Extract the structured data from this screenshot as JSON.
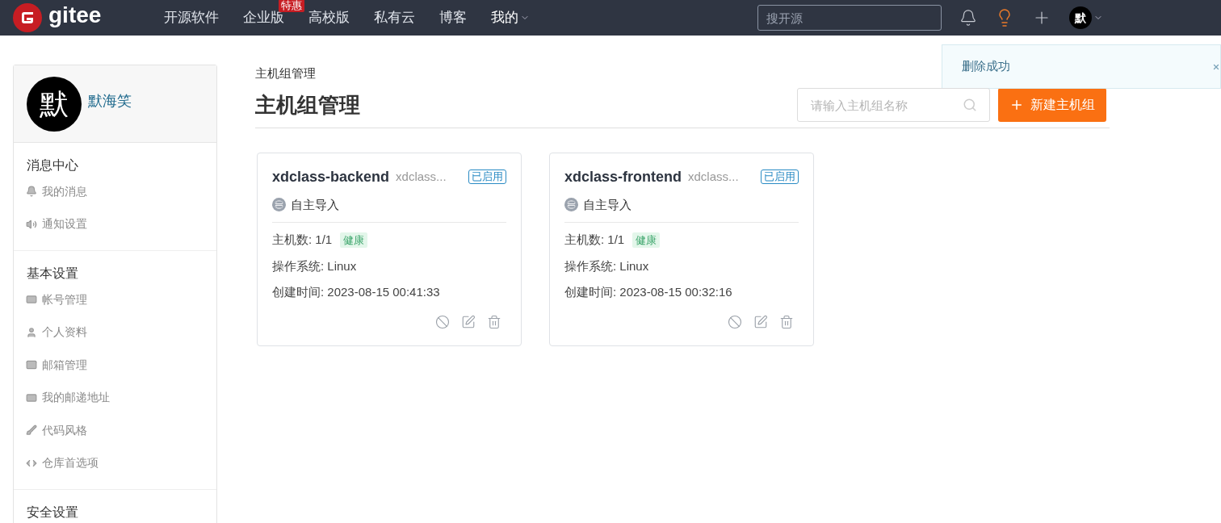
{
  "header": {
    "logo": "gitee",
    "nav": [
      {
        "label": "开源软件",
        "dropdown": false
      },
      {
        "label": "企业版",
        "badge": "特惠",
        "dropdown": false
      },
      {
        "label": "高校版",
        "dropdown": false
      },
      {
        "label": "私有云",
        "dropdown": false
      },
      {
        "label": "博客",
        "dropdown": false
      },
      {
        "label": "我的",
        "dropdown": true
      }
    ],
    "search": {
      "placeholder": "搜开源"
    },
    "avatar": "默"
  },
  "toast": {
    "message": "删除成功"
  },
  "sidebar": {
    "avatar": "默",
    "username": "默海笑",
    "sections": [
      {
        "title": "消息中心",
        "items": [
          {
            "label": "我的消息"
          },
          {
            "label": "通知设置"
          }
        ]
      },
      {
        "title": "基本设置",
        "items": [
          {
            "label": "帐号管理"
          },
          {
            "label": "个人资料"
          },
          {
            "label": "邮箱管理"
          },
          {
            "label": "我的邮递地址"
          },
          {
            "label": "代码风格"
          },
          {
            "label": "仓库首选项"
          }
        ]
      },
      {
        "title": "安全设置"
      }
    ]
  },
  "main": {
    "breadcrumb": "主机组管理",
    "title": "主机组管理",
    "search": {
      "placeholder": "请输入主机组名称"
    },
    "new_button": "新建主机组",
    "cards": [
      {
        "name": "xdclass-backend",
        "subtitle": "xdclass...",
        "status": "已启用",
        "source": "自主导入",
        "hosts_label": "主机数: 1/1",
        "health": "健康",
        "os": "操作系统: Linux",
        "created": "创建时间: 2023-08-15 00:41:33"
      },
      {
        "name": "xdclass-frontend",
        "subtitle": "xdclass...",
        "status": "已启用",
        "source": "自主导入",
        "hosts_label": "主机数: 1/1",
        "health": "健康",
        "os": "操作系统: Linux",
        "created": "创建时间: 2023-08-15 00:32:16"
      }
    ]
  }
}
